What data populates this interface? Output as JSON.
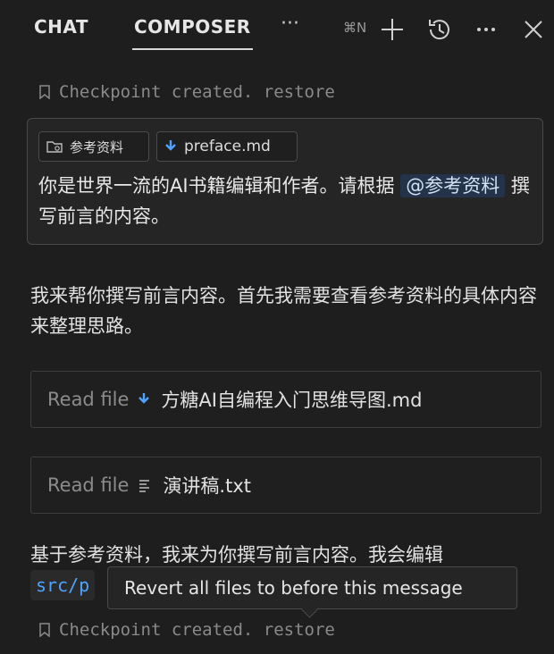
{
  "header": {
    "tabs": [
      {
        "label": "CHAT"
      },
      {
        "label": "COMPOSER",
        "active": true
      }
    ],
    "more_label": "···",
    "new_shortcut": "⌘N",
    "icons": [
      "plus-icon",
      "history-icon",
      "more-icon",
      "close-icon"
    ]
  },
  "checkpoint_top": {
    "text": "Checkpoint created.",
    "action": "restore"
  },
  "user_message": {
    "attachments": [
      {
        "icon": "folder-icon",
        "label": "参考资料"
      },
      {
        "icon": "download-arrow-icon",
        "label": "preface.md"
      }
    ],
    "text_before": "你是世界一流的AI书籍编辑和作者。请根据 ",
    "mention": "@参考资料",
    "text_after": " 撰写前言的内容。"
  },
  "assistant": {
    "intro": "我来帮你撰写前言内容。首先我需要查看参考资料的具体内容来整理思路。",
    "file_reads": [
      {
        "action": "Read file",
        "icon": "download-arrow-icon",
        "name": "方糖AI自编程入门思维导图.md"
      },
      {
        "action": "Read file",
        "icon": "text-file-icon",
        "name": "演讲稿.txt"
      }
    ],
    "followup_text": "基于参考资料，我来为你撰写前言内容。我会编辑",
    "followup_code": "src/p"
  },
  "checkpoint_bottom": {
    "text": "Checkpoint created.",
    "action": "restore"
  },
  "tooltip": {
    "text": "Revert all files to before this message"
  },
  "colors": {
    "background": "#1e1e1e",
    "mention_bg": "#22334a",
    "code_text": "#4fa3ff",
    "arrow_icon": "#4fa3ff"
  }
}
